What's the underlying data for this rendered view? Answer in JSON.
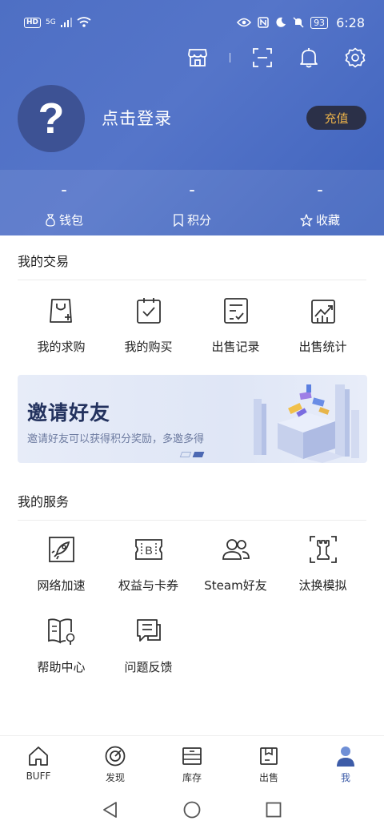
{
  "status_bar": {
    "hd": "HD",
    "network": "5G",
    "battery": "93",
    "time": "6:28"
  },
  "toolbar": {
    "icons": [
      "store-icon",
      "scan-icon",
      "bell-icon",
      "gear-icon"
    ]
  },
  "profile": {
    "avatar_glyph": "?",
    "login_text": "点击登录",
    "recharge_label": "充值"
  },
  "stats": [
    {
      "value": "–",
      "label": "钱包",
      "icon": "wallet-icon"
    },
    {
      "value": "–",
      "label": "积分",
      "icon": "points-icon"
    },
    {
      "value": "–",
      "label": "收藏",
      "icon": "star-icon"
    }
  ],
  "trades": {
    "title": "我的交易",
    "items": [
      {
        "label": "我的求购",
        "icon": "bag-plus-icon"
      },
      {
        "label": "我的购买",
        "icon": "clipboard-check-icon"
      },
      {
        "label": "出售记录",
        "icon": "list-check-icon"
      },
      {
        "label": "出售统计",
        "icon": "chart-trend-icon"
      }
    ]
  },
  "banner": {
    "title": "邀请好友",
    "subtitle": "邀请好友可以获得积分奖励，多邀多得"
  },
  "services": {
    "title": "我的服务",
    "items": [
      {
        "label": "网络加速",
        "icon": "rocket-icon"
      },
      {
        "label": "权益与卡券",
        "icon": "coupon-icon"
      },
      {
        "label": "Steam好友",
        "icon": "friends-icon"
      },
      {
        "label": "汰换模拟",
        "icon": "chess-rook-icon"
      },
      {
        "label": "帮助中心",
        "icon": "help-book-icon"
      },
      {
        "label": "问题反馈",
        "icon": "feedback-icon"
      }
    ]
  },
  "bottom_nav": [
    {
      "label": "BUFF",
      "icon": "home-icon"
    },
    {
      "label": "发现",
      "icon": "discover-icon"
    },
    {
      "label": "库存",
      "icon": "inventory-icon"
    },
    {
      "label": "出售",
      "icon": "sell-box-icon"
    },
    {
      "label": "我",
      "icon": "user-icon",
      "active": true
    }
  ],
  "colors": {
    "header": "#4e6fc4",
    "recharge_bg": "#2b3048",
    "recharge_text": "#e8b04a",
    "active_tab": "#3d5ca8"
  }
}
